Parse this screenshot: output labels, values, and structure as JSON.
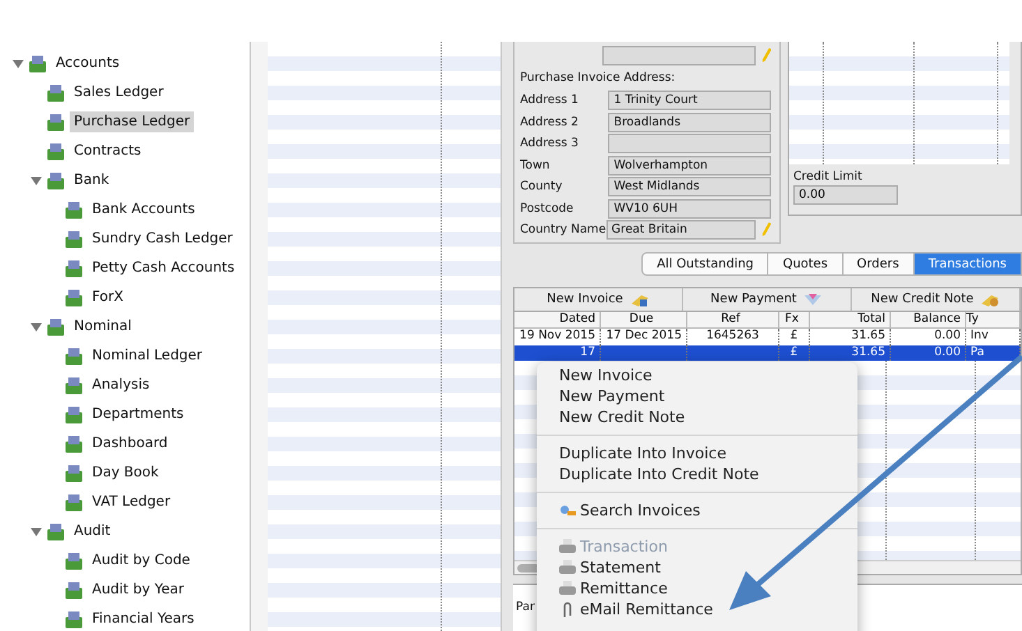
{
  "sidebar": {
    "items": [
      {
        "label": "Accounts",
        "expanded": true,
        "selected": false,
        "children": [
          {
            "label": "Sales Ledger",
            "selected": false
          },
          {
            "label": "Purchase Ledger",
            "selected": true
          },
          {
            "label": "Contracts",
            "selected": false
          },
          {
            "label": "Bank",
            "expanded": true,
            "selected": false,
            "children": [
              {
                "label": "Bank Accounts",
                "selected": false
              },
              {
                "label": "Sundry Cash Ledger",
                "selected": false
              },
              {
                "label": "Petty Cash Accounts",
                "selected": false
              },
              {
                "label": "ForX",
                "selected": false
              }
            ]
          },
          {
            "label": "Nominal",
            "expanded": true,
            "selected": false,
            "children": [
              {
                "label": "Nominal Ledger",
                "selected": false
              },
              {
                "label": "Analysis",
                "selected": false
              },
              {
                "label": "Departments",
                "selected": false
              },
              {
                "label": "Dashboard",
                "selected": false
              },
              {
                "label": "Day Book",
                "selected": false
              },
              {
                "label": "VAT Ledger",
                "selected": false
              }
            ]
          },
          {
            "label": "Audit",
            "expanded": true,
            "selected": false,
            "children": [
              {
                "label": "Audit by Code",
                "selected": false
              },
              {
                "label": "Audit by Year",
                "selected": false
              },
              {
                "label": "Financial Years",
                "selected": false
              }
            ]
          }
        ]
      }
    ]
  },
  "address": {
    "heading": "Purchase Invoice Address:",
    "fields": [
      {
        "label": "Address 1",
        "value": "1 Trinity Court"
      },
      {
        "label": "Address 2",
        "value": "Broadlands"
      },
      {
        "label": "Address 3"
      },
      {
        "label": "Town",
        "value": "Wolverhampton"
      },
      {
        "label": "County",
        "value": "West Midlands"
      },
      {
        "label": "Postcode",
        "value": "WV10 6UH"
      },
      {
        "label": "Country Name",
        "value": "Great Britain"
      }
    ]
  },
  "credit_limit": {
    "label": "Credit Limit",
    "value": "0.00"
  },
  "tabs": [
    {
      "label": "All Outstanding",
      "selected": false
    },
    {
      "label": "Quotes",
      "selected": false
    },
    {
      "label": "Orders",
      "selected": false
    },
    {
      "label": "Transactions",
      "selected": true
    }
  ],
  "toolbar": [
    {
      "label": "New Invoice",
      "kind": "invoice"
    },
    {
      "label": "New Payment",
      "kind": "payment"
    },
    {
      "label": "New Credit Note",
      "kind": "credit"
    }
  ],
  "table": {
    "columns": [
      "Dated",
      "Due",
      "Ref",
      "Fx",
      "Total",
      "Balance",
      "Ty"
    ],
    "rows": [
      {
        "cells": [
          "19 Nov 2015",
          "17 Dec 2015",
          "1645263",
          "£",
          "31.65",
          "0.00",
          "Inv"
        ],
        "selected": false
      },
      {
        "cells": [
          "17",
          "",
          "",
          "£",
          "31.65",
          "0.00",
          "Pa"
        ],
        "selected": true
      }
    ]
  },
  "context_menu": {
    "groups": [
      [
        {
          "label": "New Invoice",
          "kind": "plain",
          "disabled": false
        },
        {
          "label": "New Payment",
          "kind": "plain",
          "disabled": false
        },
        {
          "label": "New Credit Note",
          "kind": "plain",
          "disabled": false
        }
      ],
      [
        {
          "label": "Duplicate Into Invoice",
          "kind": "plain",
          "disabled": false
        },
        {
          "label": "Duplicate Into Credit Note",
          "kind": "plain",
          "disabled": false
        }
      ],
      [
        {
          "label": "Search Invoices",
          "kind": "search",
          "disabled": false
        }
      ],
      [
        {
          "label": "Transaction",
          "kind": "print",
          "disabled": true
        },
        {
          "label": "Statement",
          "kind": "print",
          "disabled": false
        },
        {
          "label": "Remittance",
          "kind": "print",
          "disabled": false
        },
        {
          "label": "eMail Remittance",
          "kind": "attach",
          "disabled": false
        }
      ]
    ]
  },
  "footer": {
    "label": "Par"
  }
}
